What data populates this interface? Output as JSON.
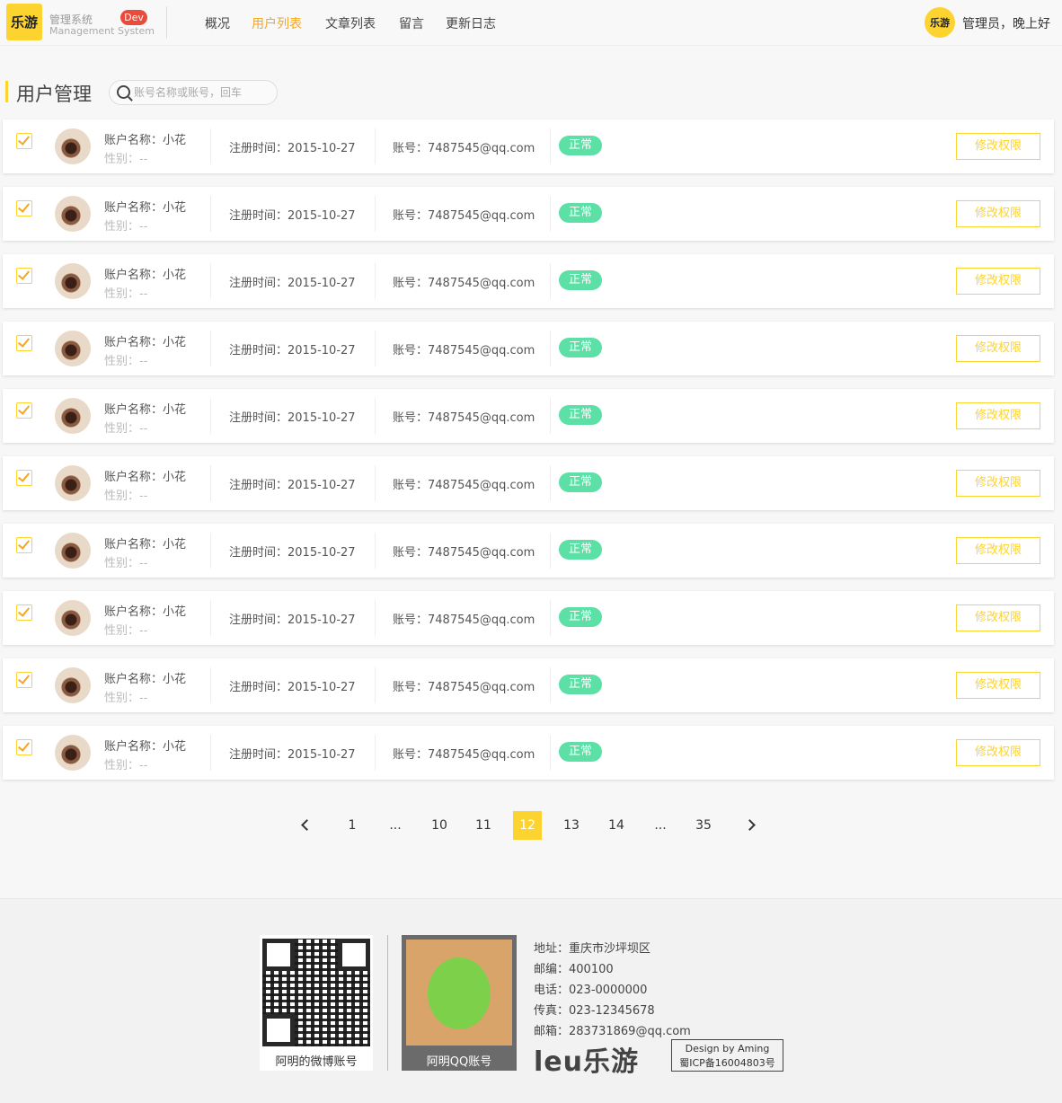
{
  "header": {
    "logo_text": "乐游",
    "brand_cn": "管理系统",
    "brand_en": "Management System",
    "dev_badge": "Dev",
    "nav": [
      {
        "label": "概况",
        "active": false
      },
      {
        "label": "用户列表",
        "active": true
      },
      {
        "label": "文章列表",
        "active": false
      },
      {
        "label": "留言",
        "active": false
      },
      {
        "label": "更新日志",
        "active": false
      }
    ],
    "admin_avatar_text": "乐游",
    "greeting": "管理员，晚上好"
  },
  "page": {
    "title": "用户管理",
    "search_placeholder": "账号名称或账号，回车"
  },
  "users": [
    {
      "name": "账户名称：小花",
      "gender": "性别：--",
      "reg": "注册时间：2015-10-27",
      "account": "账号：7487545@qq.com",
      "status": "正常",
      "action": "修改权限",
      "checked": true
    },
    {
      "name": "账户名称：小花",
      "gender": "性别：--",
      "reg": "注册时间：2015-10-27",
      "account": "账号：7487545@qq.com",
      "status": "正常",
      "action": "修改权限",
      "checked": true
    },
    {
      "name": "账户名称：小花",
      "gender": "性别：--",
      "reg": "注册时间：2015-10-27",
      "account": "账号：7487545@qq.com",
      "status": "正常",
      "action": "修改权限",
      "checked": true
    },
    {
      "name": "账户名称：小花",
      "gender": "性别：--",
      "reg": "注册时间：2015-10-27",
      "account": "账号：7487545@qq.com",
      "status": "正常",
      "action": "修改权限",
      "checked": true
    },
    {
      "name": "账户名称：小花",
      "gender": "性别：--",
      "reg": "注册时间：2015-10-27",
      "account": "账号：7487545@qq.com",
      "status": "正常",
      "action": "修改权限",
      "checked": true
    },
    {
      "name": "账户名称：小花",
      "gender": "性别：--",
      "reg": "注册时间：2015-10-27",
      "account": "账号：7487545@qq.com",
      "status": "正常",
      "action": "修改权限",
      "checked": true
    },
    {
      "name": "账户名称：小花",
      "gender": "性别：--",
      "reg": "注册时间：2015-10-27",
      "account": "账号：7487545@qq.com",
      "status": "正常",
      "action": "修改权限",
      "checked": true
    },
    {
      "name": "账户名称：小花",
      "gender": "性别：--",
      "reg": "注册时间：2015-10-27",
      "account": "账号：7487545@qq.com",
      "status": "正常",
      "action": "修改权限",
      "checked": true
    },
    {
      "name": "账户名称：小花",
      "gender": "性别：--",
      "reg": "注册时间：2015-10-27",
      "account": "账号：7487545@qq.com",
      "status": "正常",
      "action": "修改权限",
      "checked": true
    },
    {
      "name": "账户名称：小花",
      "gender": "性别：--",
      "reg": "注册时间：2015-10-27",
      "account": "账号：7487545@qq.com",
      "status": "正常",
      "action": "修改权限",
      "checked": true
    }
  ],
  "pagination": {
    "pages": [
      "1",
      "...",
      "10",
      "11",
      "12",
      "13",
      "14",
      "...",
      "35"
    ],
    "current": "12"
  },
  "footer": {
    "weibo_label": "阿明的微博账号",
    "qq_label": "阿明QQ账号",
    "info": [
      "地址：重庆市沙坪坝区",
      "邮编：400100",
      "电话：023-0000000",
      "传真：023-12345678",
      "邮箱：283731869@qq.com"
    ],
    "logo_latin": "leu",
    "logo_cn": "乐游",
    "design": "Design by Aming",
    "icp": "蜀ICP备16004803号"
  },
  "colors": {
    "accent": "#fdd32f",
    "nav_active": "#f5a623",
    "status_ok": "#5de0a6",
    "dev_badge": "#e94b3c"
  }
}
